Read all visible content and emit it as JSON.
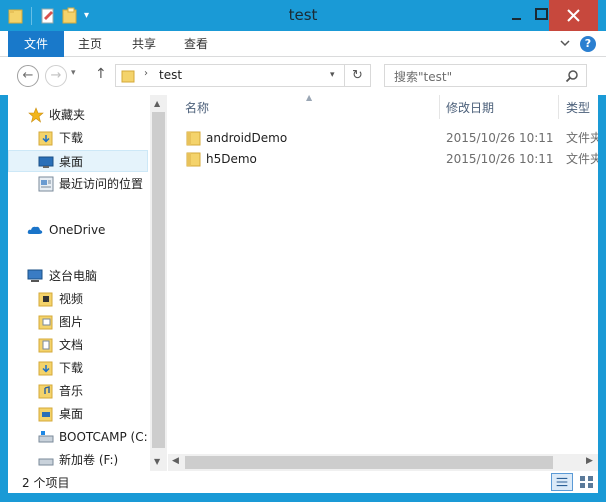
{
  "window": {
    "title": "test"
  },
  "ribbon": {
    "tabs": [
      {
        "label": "文件"
      },
      {
        "label": "主页"
      },
      {
        "label": "共享"
      },
      {
        "label": "查看"
      }
    ],
    "help": "?"
  },
  "address": {
    "path": "test",
    "search_placeholder": "搜索\"test\""
  },
  "nav": {
    "items": [
      {
        "label": "收藏夹",
        "icon": "star-icon"
      },
      {
        "label": "下载",
        "icon": "downloads-folder-icon"
      },
      {
        "label": "桌面",
        "icon": "desktop-icon"
      },
      {
        "label": "最近访问的位置",
        "icon": "recent-places-icon"
      },
      {
        "label": "OneDrive",
        "icon": "onedrive-cloud-icon"
      },
      {
        "label": "这台电脑",
        "icon": "computer-icon"
      },
      {
        "label": "视频",
        "icon": "videos-folder-icon"
      },
      {
        "label": "图片",
        "icon": "pictures-folder-icon"
      },
      {
        "label": "文档",
        "icon": "documents-folder-icon"
      },
      {
        "label": "下载",
        "icon": "downloads-folder-icon"
      },
      {
        "label": "音乐",
        "icon": "music-folder-icon"
      },
      {
        "label": "桌面",
        "icon": "desktop-folder-icon"
      },
      {
        "label": "BOOTCAMP (C:",
        "icon": "drive-icon"
      },
      {
        "label": "新加卷 (F:)",
        "icon": "drive-icon"
      }
    ]
  },
  "columns": {
    "name": "名称",
    "date": "修改日期",
    "type": "类型"
  },
  "files": [
    {
      "name": "androidDemo",
      "date": "2015/10/26 10:11",
      "type": "文件夹"
    },
    {
      "name": "h5Demo",
      "date": "2015/10/26 10:11",
      "type": "文件夹"
    }
  ],
  "status": {
    "item_count": "2 个项目"
  },
  "colors": {
    "titlebar": "#1a9ad6",
    "file_tab": "#1979ca",
    "close": "#c7483d",
    "folder": "#e8c25a"
  }
}
